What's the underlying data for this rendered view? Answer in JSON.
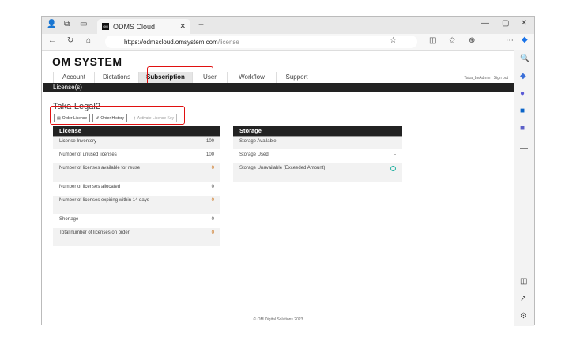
{
  "browser": {
    "tab_title": "ODMS Cloud",
    "url_host": "https://odmscloud.omsystem.com",
    "url_path": "/license"
  },
  "app": {
    "logo": "OM SYSTEM",
    "nav": [
      "Account",
      "Dictations",
      "Subscription",
      "User",
      "Workflow",
      "Support"
    ],
    "active_nav": "Subscription",
    "user": "Taka_LeAdmin",
    "signout": "Sign out",
    "section_bar": "License(s)"
  },
  "page": {
    "title": "Taka-Legal2",
    "buttons": {
      "order_license": "Order License",
      "order_history": "Order History",
      "activate_key": "Activate License Key"
    }
  },
  "license": {
    "header": "License",
    "rows": [
      {
        "label": "License Inventory",
        "value": "100"
      },
      {
        "label": "Number of unused licenses",
        "value": "100"
      },
      {
        "label": "Number of licenses available for reuse",
        "value": "0"
      },
      {
        "label": "Number of licenses allocated",
        "value": "0"
      },
      {
        "label": "Number of licenses expiring within 14 days",
        "value": "0"
      },
      {
        "label": "Shortage",
        "value": "0"
      },
      {
        "label": "Total number of licenses on order",
        "value": "0"
      }
    ]
  },
  "storage": {
    "header": "Storage",
    "rows": [
      {
        "label": "Storage Available",
        "value": "-"
      },
      {
        "label": "Storage Used",
        "value": "-"
      },
      {
        "label": "Storage Unavailable (Exceeded Amount)",
        "value": ""
      }
    ]
  },
  "footer": "© OM Digital Solutions 2023",
  "colors": {
    "highlight": "#e01010",
    "header_bg": "#222222",
    "status_circle": "#20b0a0"
  }
}
